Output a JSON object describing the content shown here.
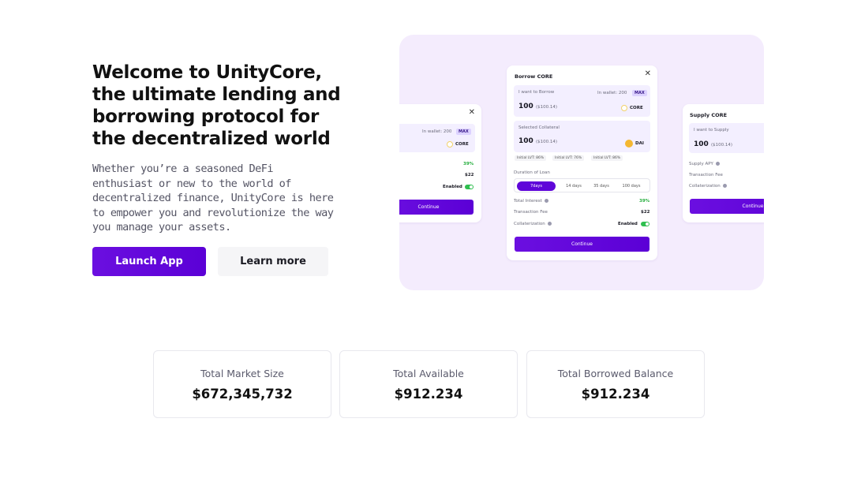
{
  "hero": {
    "title": "Welcome to UnityCore, the ultimate lending and borrowing protocol for the decentralized world",
    "description": "Whether you’re a seasoned DeFi enthusiast or new to the world of decentralized finance, UnityCore is here to empower you and revolutionize the way you manage your assets.",
    "launch_label": "Launch App",
    "learn_label": "Learn more"
  },
  "colors": {
    "accent": "#5f06d9",
    "panel_bg": "#f4ecfd",
    "success": "#27ae3f"
  },
  "illustration": {
    "left_card": {
      "wallet": "In wallet: 200",
      "max": "MAX",
      "token": "CORE",
      "interest": "39%",
      "fee": "$22",
      "collateral_state": "Enabled",
      "button": "Continue"
    },
    "borrow_card": {
      "title": "Borrow CORE",
      "want_label": "I want to Borrow",
      "wallet": "In wallet: 200",
      "max": "MAX",
      "amount": "100",
      "amount_usd": "($100.14)",
      "token": "CORE",
      "collateral_label": "Selected Collateral",
      "collateral_amount": "100",
      "collateral_usd": "($100.14)",
      "collateral_token": "DAI",
      "ltv": [
        "Initial LVT: 86%",
        "Initial LVT: 76%",
        "Initial LVT: 86%"
      ],
      "duration_label": "Duration of Loan",
      "durations": [
        "7days",
        "14 days",
        "35 days",
        "100 days"
      ],
      "interest_label": "Total Interest",
      "interest_value": "39%",
      "fee_label": "Transaction Fee",
      "fee_value": "$22",
      "collat_label": "Collaterization",
      "collat_value": "Enabled",
      "button": "Continue"
    },
    "supply_card": {
      "title": "Supply CORE",
      "want_label": "I want to Supply",
      "amount": "100",
      "amount_usd": "($100.14)",
      "apy_label": "Supply APY",
      "fee_label": "Transaction Fee",
      "collat_label": "Collaterization",
      "button": "Continue"
    }
  },
  "stats": [
    {
      "label": "Total Market Size",
      "value": "$672,345,732"
    },
    {
      "label": "Total Available",
      "value": "$912.234"
    },
    {
      "label": "Total Borrowed Balance",
      "value": "$912.234"
    }
  ]
}
